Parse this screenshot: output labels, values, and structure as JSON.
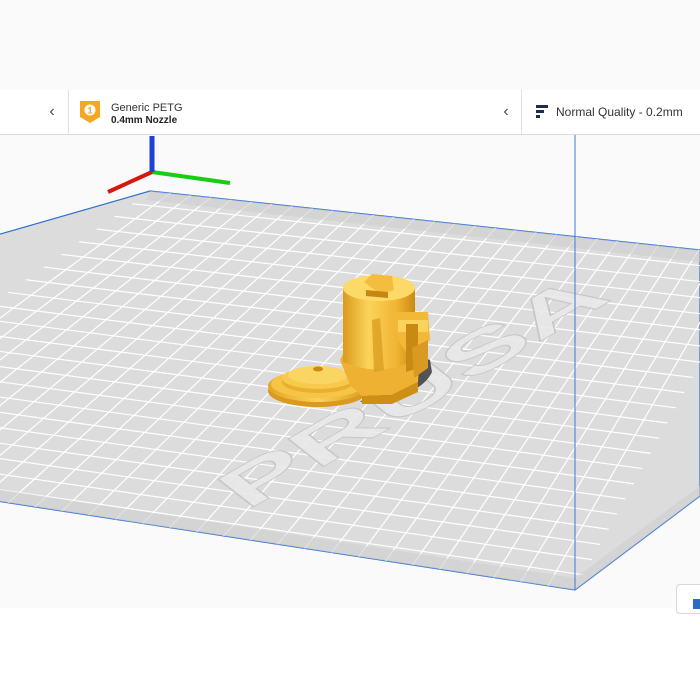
{
  "header": {
    "extruder": {
      "badge_number": "1",
      "material": "Generic PETG",
      "nozzle": "0.4mm Nozzle",
      "badge_color": "#f5a623"
    },
    "quality": {
      "label": "Normal Quality - 0.2mm",
      "icon": "quality-bars-icon"
    },
    "collapse_icon": "chevron-left-icon"
  },
  "viewport": {
    "background": "#fafafa",
    "build_plate_color": "#dcdcdc",
    "grid_line_color": "#ffffff",
    "plate_edge_color": "#2f6fcf",
    "model_color": "#f6c13f",
    "axis_colors": {
      "x": "#d4190f",
      "y": "#1bcc14",
      "z": "#1f3fd6"
    },
    "plate_logo_text": "PRUSA"
  },
  "bottom_action": {
    "icon": "view-toggle-icon"
  }
}
